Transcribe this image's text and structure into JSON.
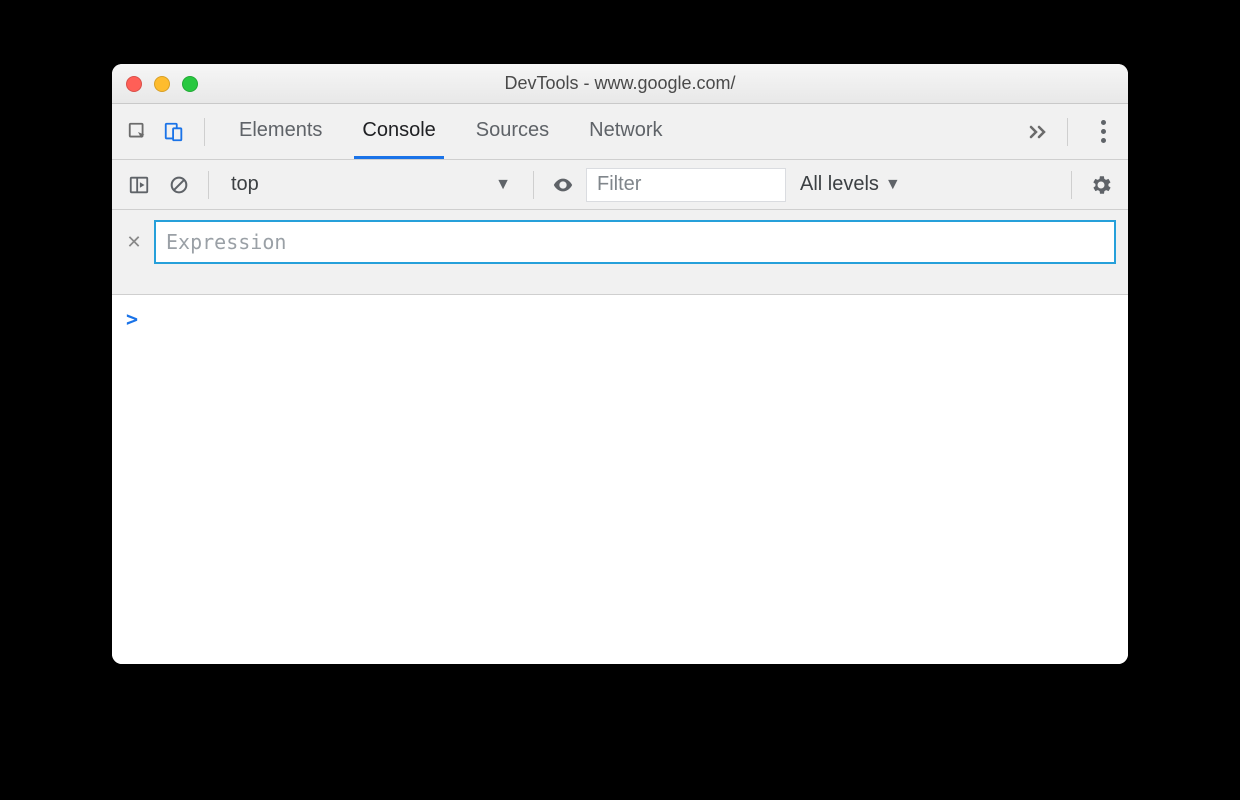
{
  "window": {
    "title": "DevTools - www.google.com/"
  },
  "tabs": {
    "items": [
      "Elements",
      "Console",
      "Sources",
      "Network"
    ],
    "active": "Console"
  },
  "toolbar": {
    "context_value": "top",
    "filter_placeholder": "Filter",
    "levels_label": "All levels"
  },
  "live_expression": {
    "placeholder": "Expression",
    "value": ""
  },
  "console": {
    "prompt": ">"
  }
}
